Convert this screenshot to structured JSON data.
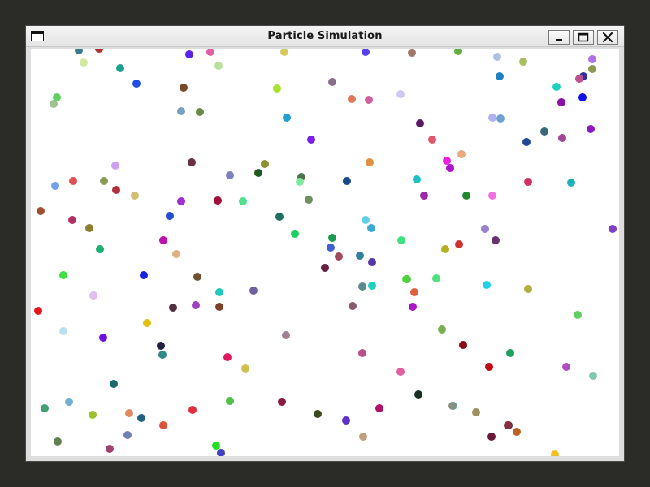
{
  "window": {
    "title": "Particle Simulation",
    "icons": {
      "app": "window-icon",
      "minimize": "minimize-icon",
      "maximize": "maximize-icon",
      "close": "close-icon"
    }
  },
  "colors": {
    "desktop": "#2b2b28",
    "canvas_background": "#ffffff"
  },
  "particle_colors": [
    "#3a7a8a",
    "#a83434",
    "#d4e8a0",
    "#5a22e8",
    "#e060a0",
    "#d8c860",
    "#5840f0",
    "#a07868",
    "#60b040",
    "#b0c0e0",
    "#a8c060",
    "#b070e8",
    "#20a090",
    "#1e50e8",
    "#b8e0a0",
    "#2080c0",
    "#8a9a50",
    "#3030a0",
    "#c05090",
    "#20d0c0",
    "#7a4828",
    "#a8e030",
    "#8a708a",
    "#e07858",
    "#d060a0",
    "#d0c8f0",
    "#8a10a8",
    "#1010e8",
    "#60d060",
    "#a0c090",
    "#7aa0c0",
    "#6a8a48",
    "#20a0d0",
    "#b0b0f0",
    "#70a0d0",
    "#5a1a6a",
    "#386878",
    "#1e4a90",
    "#e05870",
    "#a04898",
    "#7a20e8",
    "#8a18c0",
    "#e8a880",
    "#f020e0",
    "#b010d0",
    "#d0a0f0",
    "#683040",
    "#8080c0",
    "#8a9030",
    "#205a20",
    "#507050",
    "#80e8a0",
    "#e09040",
    "#184a8a",
    "#20c0c0",
    "#d03060",
    "#20b0b8",
    "#70a0f0",
    "#e05050",
    "#8a9a50",
    "#b03040",
    "#d0c070",
    "#a030d0",
    "#a0103a",
    "#50e090",
    "#709060",
    "#9a2aa8",
    "#208a30",
    "#f070e0",
    "#a05030",
    "#b03060",
    "#8a8030",
    "#207060",
    "#60d0e8",
    "#40a8d0",
    "#9a80d0",
    "#6a3070",
    "#8040c8",
    "#2050d0",
    "#c010b0",
    "#e0b080",
    "#1ad060",
    "#1a9a50",
    "#4060d0",
    "#a04860",
    "#5838a8",
    "#6a2040",
    "#3080a0",
    "#1a20e0",
    "#b0b020",
    "#d03030",
    "#40e040",
    "#40e080",
    "#705030",
    "#20c8c0",
    "#5a8a8a",
    "#20d0c0",
    "#7060a0",
    "#60e040",
    "#e06040",
    "#50e080",
    "#d8b0e0",
    "#b0b040",
    "#e0c0f0",
    "#20d0e8",
    "#804028",
    "#a040c0",
    "#aa18c8",
    "#8a5a70",
    "#50d040",
    "#e01a20",
    "#503040",
    "#60d060",
    "#1ab070",
    "#a08090",
    "#b8e0f0",
    "#7010e0",
    "#78b050",
    "#e0c010",
    "#900818",
    "#20a060",
    "#308888",
    "#b84f8a",
    "#e01860",
    "#d0c050",
    "#202040",
    "#e060a0",
    "#c00818",
    "#b050c0",
    "#80c8b0",
    "#1a6a6a",
    "#40a070",
    "#70b0d0",
    "#50d0c0",
    "#a0c030",
    "#e08860",
    "#206080",
    "#e05040",
    "#e03040",
    "#8a1a40",
    "#b01068",
    "#3a4a1a",
    "#183020",
    "#6030c8",
    "#50c048",
    "#c0a080",
    "#a09060",
    "#4a2a50",
    "#8a9080",
    "#883040",
    "#c06020",
    "#f0c020",
    "#6a1838",
    "#608050",
    "#7080b0",
    "#a04070",
    "#20e020",
    "#4040c0",
    "#e04870",
    "#a080c8",
    "#6a1a6a",
    "#603018",
    "#b04070",
    "#a09040",
    "#60c060",
    "#a080b0"
  ],
  "particle_count": 158
}
